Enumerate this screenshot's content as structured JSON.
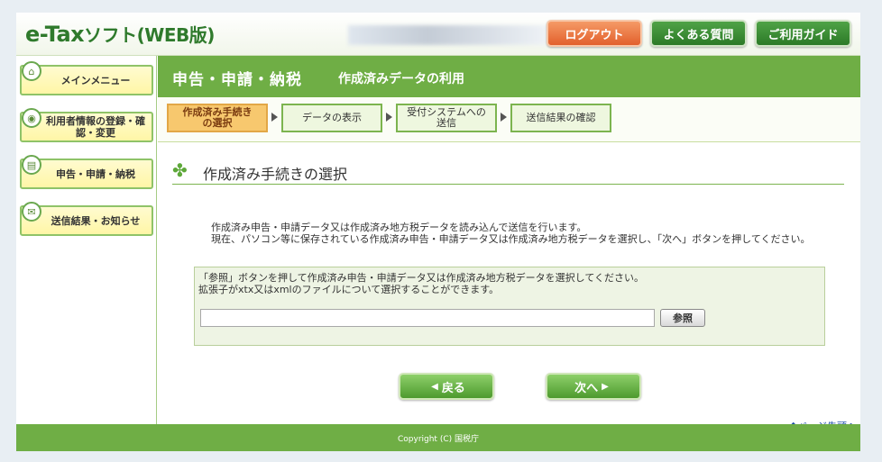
{
  "header": {
    "logo_main": "e-Tax",
    "logo_sub": "ソフト(WEB版)",
    "logout": "ログアウト",
    "faq": "よくある質問",
    "guide": "ご利用ガイド"
  },
  "sidebar": {
    "items": [
      {
        "label": "メインメニュー",
        "icon": "home-icon"
      },
      {
        "label": "利用者情報の登録・確認・変更",
        "icon": "user-settings-icon"
      },
      {
        "label": "申告・申請・納税",
        "icon": "document-icon"
      },
      {
        "label": "送信結果・お知らせ",
        "icon": "mail-icon"
      }
    ]
  },
  "main": {
    "section": "申告・申請・納税",
    "subtitle": "作成済みデータの利用"
  },
  "steps": [
    {
      "label": "作成済み手続きの選択",
      "active": true
    },
    {
      "label": "データの表示",
      "active": false
    },
    {
      "label": "受付システムへの送信",
      "active": false
    },
    {
      "label": "送信結果の確認",
      "active": false
    }
  ],
  "content": {
    "title": "作成済み手続きの選択",
    "desc1": "作成済み申告・申請データ又は作成済み地方税データを読み込んで送信を行います。",
    "desc2": "現在、パソコン等に保存されている作成済み申告・申請データ又は作成済み地方税データを選択し、「次へ」ボタンを押してください。",
    "box_line1": "「参照」ボタンを押して作成済み申告・申請データ又は作成済み地方税データを選択してください。",
    "box_line2": "拡張子がxtx又はxmlのファイルについて選択することができます。",
    "file_value": "",
    "browse": "参照",
    "back": "戻る",
    "next": "次へ",
    "pagetop": "ページ先頭へ"
  },
  "footer": {
    "copyright": "Copyright (C) 国税庁"
  }
}
